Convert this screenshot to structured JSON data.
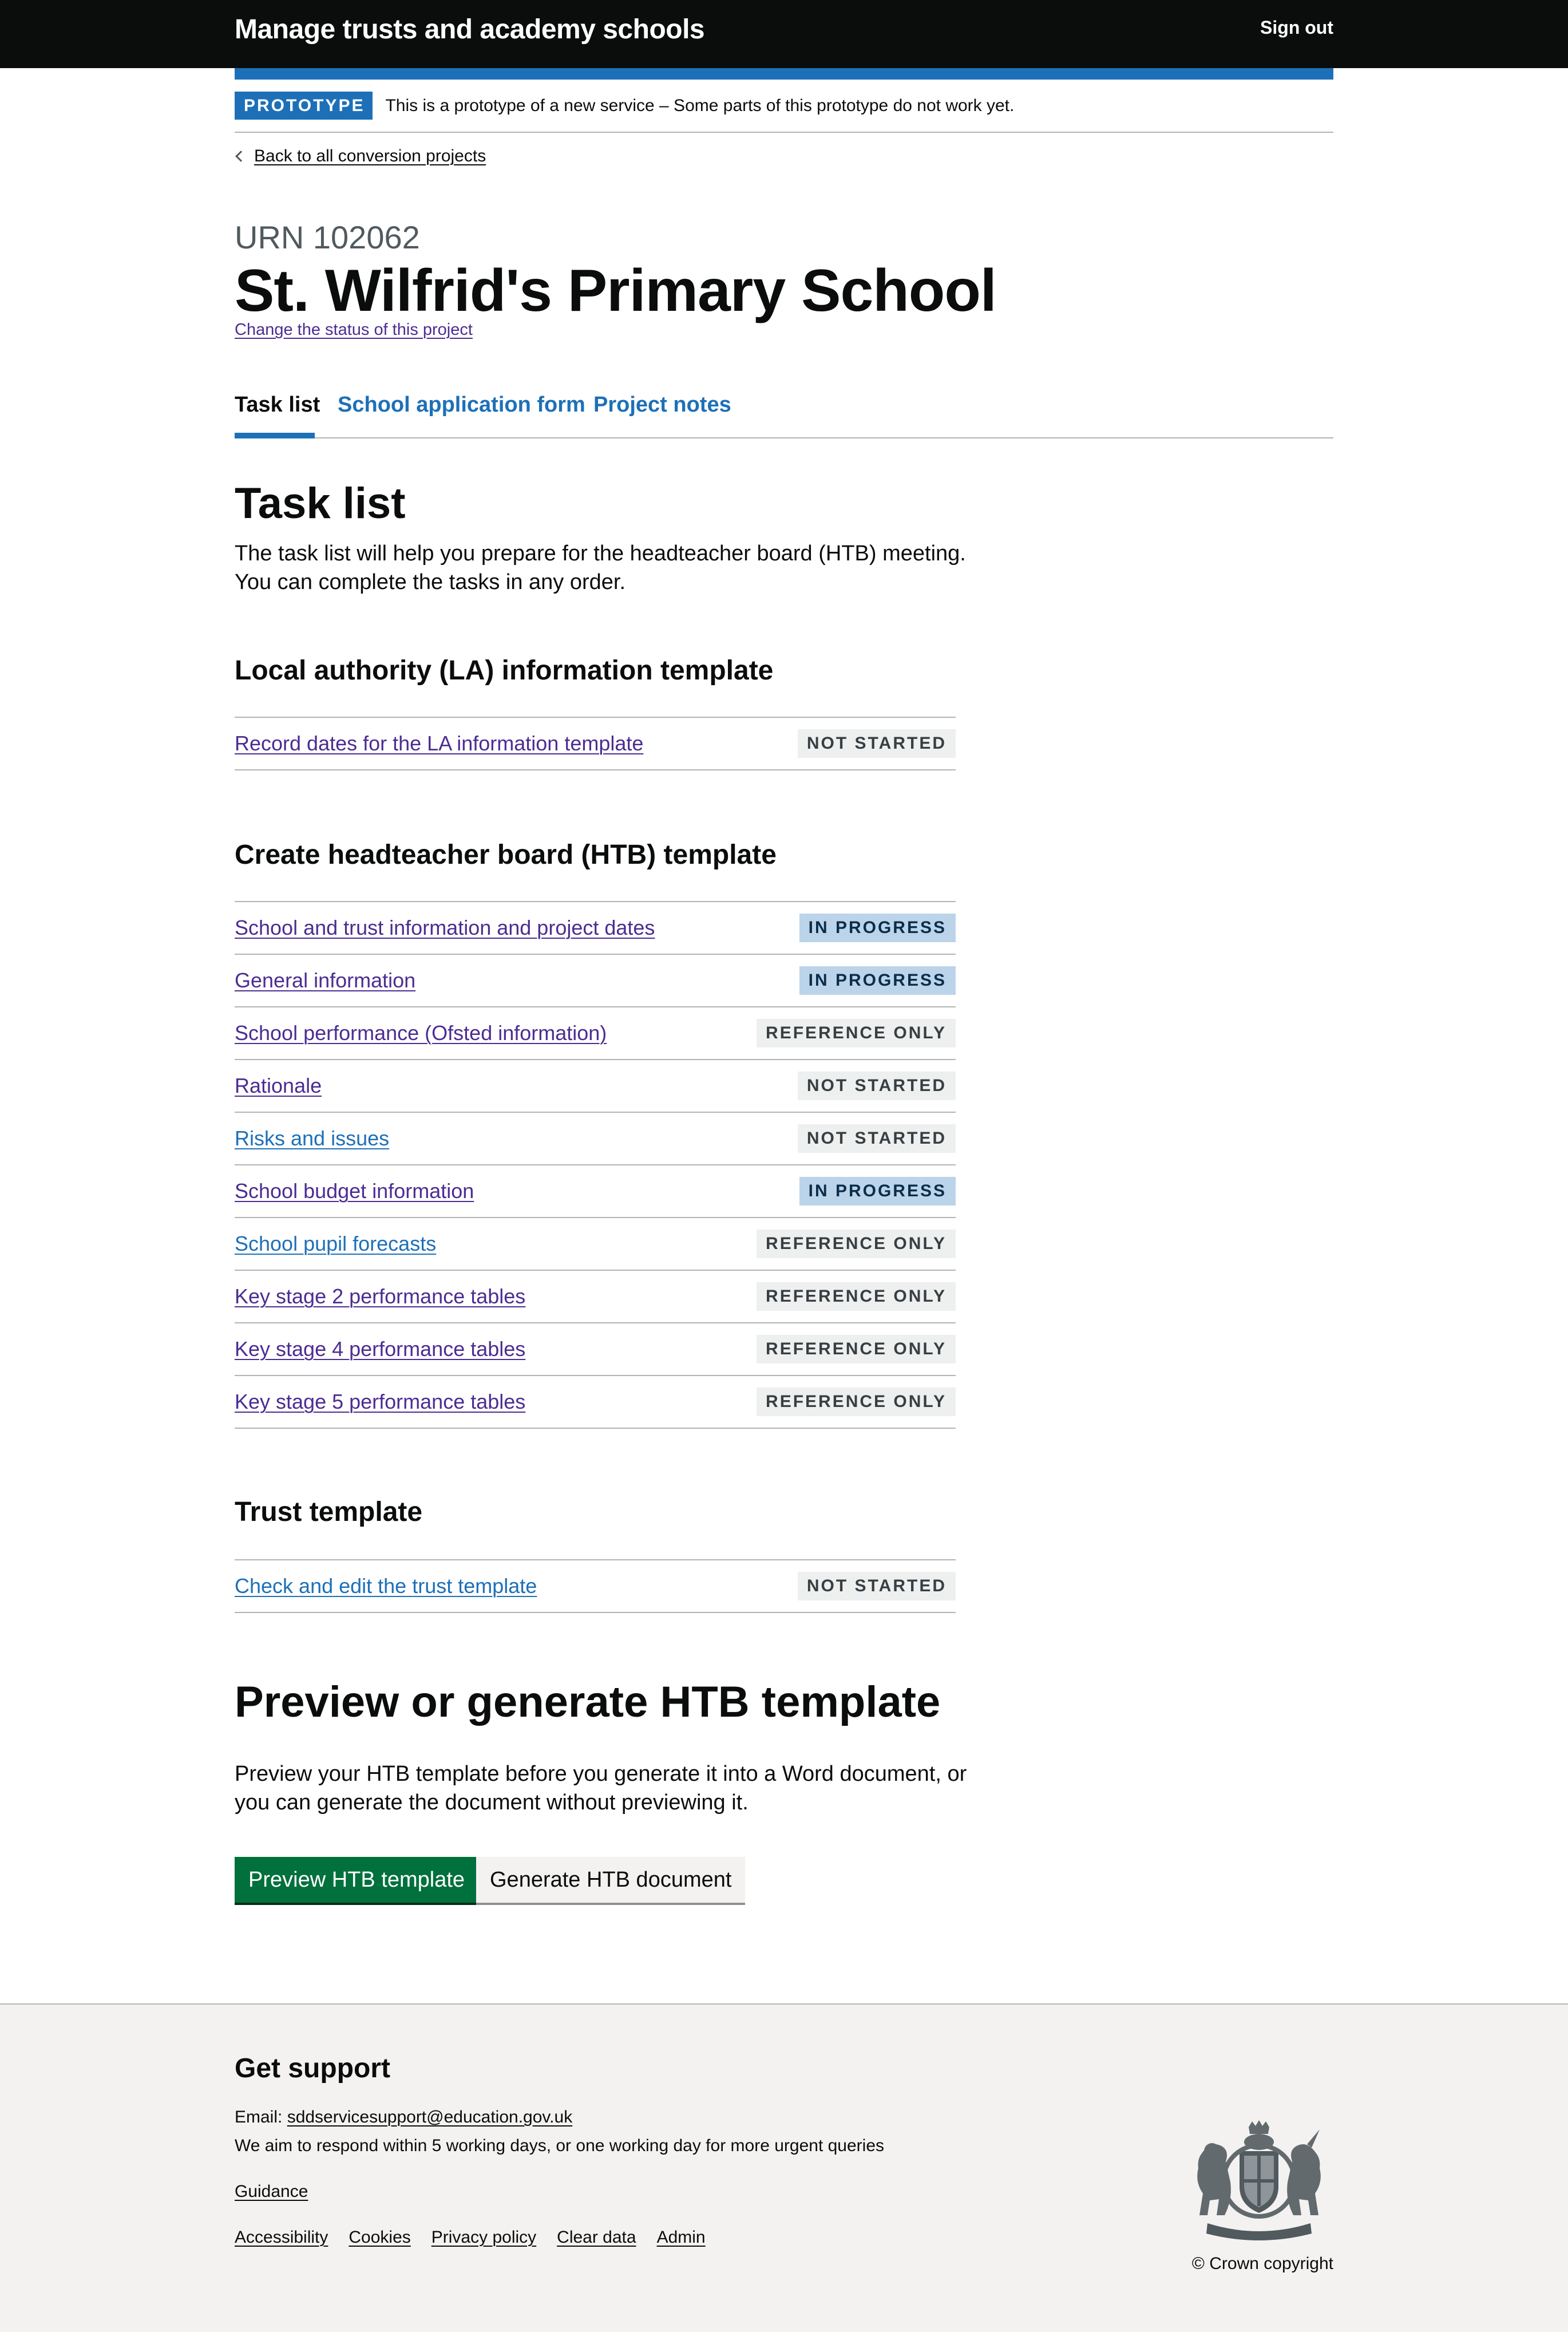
{
  "header": {
    "service_name": "Manage trusts and academy schools",
    "sign_out": "Sign out"
  },
  "phase_banner": {
    "tag": "PROTOTYPE",
    "text": "This is a prototype of a new service – Some parts of this prototype do not work yet."
  },
  "back_link": "Back to all conversion projects",
  "project": {
    "urn": "URN 102062",
    "school_name": "St. Wilfrid's Primary School",
    "change_status_link": "Change the status of this project"
  },
  "tabs": [
    {
      "label": "Task list",
      "active": true
    },
    {
      "label": "School application form",
      "active": false
    },
    {
      "label": "Project notes",
      "active": false
    }
  ],
  "task_list": {
    "heading": "Task list",
    "intro_line1": "The task list will help you prepare for the headteacher board (HTB) meeting.",
    "intro_line2": "You can complete the tasks in any order."
  },
  "sections": [
    {
      "heading": "Local authority (LA) information template",
      "tasks": [
        {
          "label": "Record dates for the LA information template",
          "status": "NOT STARTED",
          "status_style": "grey",
          "visited": true
        }
      ]
    },
    {
      "heading": "Create headteacher board (HTB) template",
      "tasks": [
        {
          "label": "School and trust information and project dates",
          "status": "IN PROGRESS",
          "status_style": "blue",
          "visited": true
        },
        {
          "label": "General information",
          "status": "IN PROGRESS",
          "status_style": "blue",
          "visited": true
        },
        {
          "label": "School performance (Ofsted information)",
          "status": "REFERENCE ONLY",
          "status_style": "grey",
          "visited": true
        },
        {
          "label": "Rationale",
          "status": "NOT STARTED",
          "status_style": "grey",
          "visited": true
        },
        {
          "label": "Risks and issues",
          "status": "NOT STARTED",
          "status_style": "grey",
          "visited": false
        },
        {
          "label": "School budget information",
          "status": "IN PROGRESS",
          "status_style": "blue",
          "visited": true
        },
        {
          "label": "School pupil forecasts",
          "status": "REFERENCE ONLY",
          "status_style": "grey",
          "visited": false
        },
        {
          "label": "Key stage 2 performance tables",
          "status": "REFERENCE ONLY",
          "status_style": "grey",
          "visited": true
        },
        {
          "label": "Key stage 4 performance tables",
          "status": "REFERENCE ONLY",
          "status_style": "grey",
          "visited": true
        },
        {
          "label": "Key stage 5 performance tables",
          "status": "REFERENCE ONLY",
          "status_style": "grey",
          "visited": true
        }
      ]
    },
    {
      "heading": "Trust template",
      "tasks": [
        {
          "label": "Check and edit the trust template",
          "status": "NOT STARTED",
          "status_style": "grey",
          "visited": false
        }
      ]
    }
  ],
  "preview": {
    "heading": "Preview or generate HTB template",
    "text_line1": "Preview your HTB template before you generate it into a Word document, or",
    "text_line2": "you can generate the document without previewing it.",
    "preview_button": "Preview HTB template",
    "generate_button": "Generate HTB document"
  },
  "footer": {
    "heading": "Get support",
    "email_label": "Email: ",
    "email": "sddservicesupport@education.gov.uk",
    "response_note": "We aim to respond within 5 working days, or one working day for more urgent queries",
    "guidance": "Guidance",
    "links": [
      "Accessibility",
      "Cookies",
      "Privacy policy",
      "Clear data",
      "Admin"
    ],
    "copyright": "© Crown copyright"
  },
  "colors": {
    "header_bg": "#0b0c0c",
    "brand_blue": "#1d70b8",
    "visited_link": "#4c2c92",
    "button_green": "#00703c",
    "footer_bg": "#f3f2f1"
  }
}
